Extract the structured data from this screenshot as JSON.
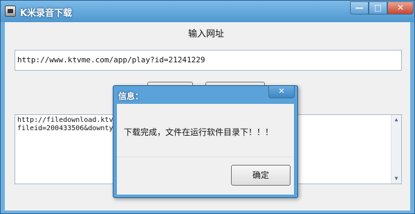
{
  "window": {
    "title": "K米录音下载",
    "controls": {
      "minimize": "—",
      "maximize": "□",
      "close": "✕"
    }
  },
  "main": {
    "url_label": "输入网址",
    "url_value": "http://www.ktvme.com/app/play?id=21241229",
    "output_text": "http://filedownload.ktvm\nfileid=200433506&downtyp"
  },
  "dialog": {
    "title": "信息：",
    "close": "✕",
    "message": "下载完成，文件在运行软件目录下！！！",
    "ok_label": "确定"
  },
  "icons": {
    "app": "app-icon",
    "scroll_up": "chevron-up-icon",
    "scroll_down": "chevron-down-icon"
  }
}
